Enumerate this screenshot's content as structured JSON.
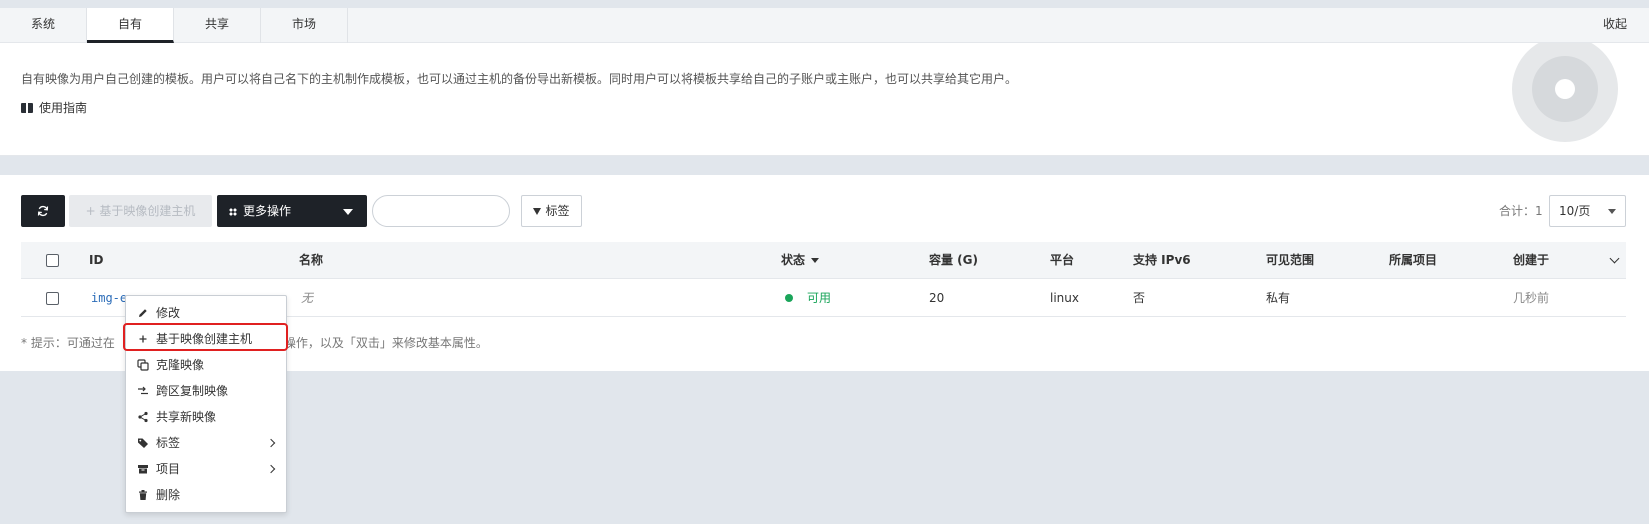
{
  "tabs": {
    "items": [
      {
        "label": "系统"
      },
      {
        "label": "自有"
      },
      {
        "label": "共享"
      },
      {
        "label": "市场"
      }
    ],
    "active": "自有",
    "collapse_label": "收起"
  },
  "intro": {
    "description": "自有映像为用户自己创建的模板。用户可以将自己名下的主机制作成模板，也可以通过主机的备份导出新模板。同时用户可以将模板共享给自己的子账户或主账户，也可以共享给其它用户。",
    "guide_label": "使用指南"
  },
  "toolbar": {
    "refresh_icon": "refresh-icon",
    "create_label": "+ 基于映像创建主机",
    "more_label": "更多操作",
    "search_placeholder": "",
    "tag_label": "标签",
    "total_label": "合计：1",
    "page_size": "10/页"
  },
  "table": {
    "headers": {
      "id": "ID",
      "name": "名称",
      "status": "状态",
      "capacity": "容量 (G)",
      "platform": "平台",
      "ipv6": "支持 IPv6",
      "visibility": "可见范围",
      "project": "所属项目",
      "created": "创建于"
    },
    "rows": [
      {
        "id": "img-e",
        "name": "无",
        "status": "可用",
        "capacity": "20",
        "platform": "linux",
        "ipv6": "否",
        "visibility": "私有",
        "project": "",
        "created": "几秒前"
      }
    ]
  },
  "hint": {
    "prefix": "* 提示：可通过在",
    "suffix": "常用操作，以及「双击」来修改基本属性。"
  },
  "context_menu": {
    "items": [
      {
        "label": "修改",
        "icon": "pencil-icon"
      },
      {
        "label": "基于映像创建主机",
        "icon": "plus-icon"
      },
      {
        "label": "克隆映像",
        "icon": "clone-icon"
      },
      {
        "label": "跨区复制映像",
        "icon": "transfer-icon"
      },
      {
        "label": "共享新映像",
        "icon": "share-icon"
      },
      {
        "label": "标签",
        "icon": "tag-icon"
      },
      {
        "label": "项目",
        "icon": "archive-icon"
      },
      {
        "label": "删除",
        "icon": "trash-icon"
      }
    ]
  },
  "colors": {
    "dark": "#1e2228",
    "link": "#2b6cb8",
    "status_ok": "#1aa55a",
    "highlight": "#e02020"
  }
}
